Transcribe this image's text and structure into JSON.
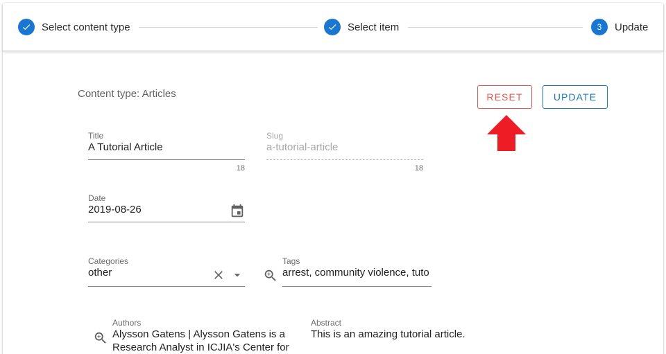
{
  "stepper": {
    "steps": [
      {
        "label": "Select content type",
        "state": "complete",
        "icon": "check-icon"
      },
      {
        "label": "Select item",
        "state": "complete",
        "icon": "check-icon"
      },
      {
        "label": "Update",
        "state": "active",
        "number": "3"
      }
    ]
  },
  "form": {
    "content_type_text": "Content type: Articles",
    "reset_label": "RESET",
    "update_label": "UPDATE",
    "title": {
      "label": "Title",
      "value": "A Tutorial Article",
      "counter": "18"
    },
    "slug": {
      "label": "Slug",
      "value": "a-tutorial-article",
      "counter": "18"
    },
    "date": {
      "label": "Date",
      "value": "2019-08-26",
      "icon": "calendar-icon"
    },
    "categories": {
      "label": "Categories",
      "value": "other",
      "clear_icon": "close-icon",
      "dropdown_icon": "dropdown-arrow-icon"
    },
    "tags": {
      "label": "Tags",
      "value": "arrest, community violence, tuto",
      "icon": "search-icon"
    },
    "authors": {
      "label": "Authors",
      "value_line1": "Alysson Gatens | Alysson Gatens is a",
      "value_line2": "Research Analyst in ICJIA's Center for",
      "icon": "search-icon"
    },
    "abstract": {
      "label": "Abstract",
      "value": "This is an amazing tutorial article."
    }
  },
  "annotation": {
    "arrow_color": "#ee1c25",
    "arrow_icon": "red-up-arrow"
  },
  "colors": {
    "primary": "#1976d2",
    "reset": "#ef5350",
    "arrow": "#ee1c25"
  }
}
